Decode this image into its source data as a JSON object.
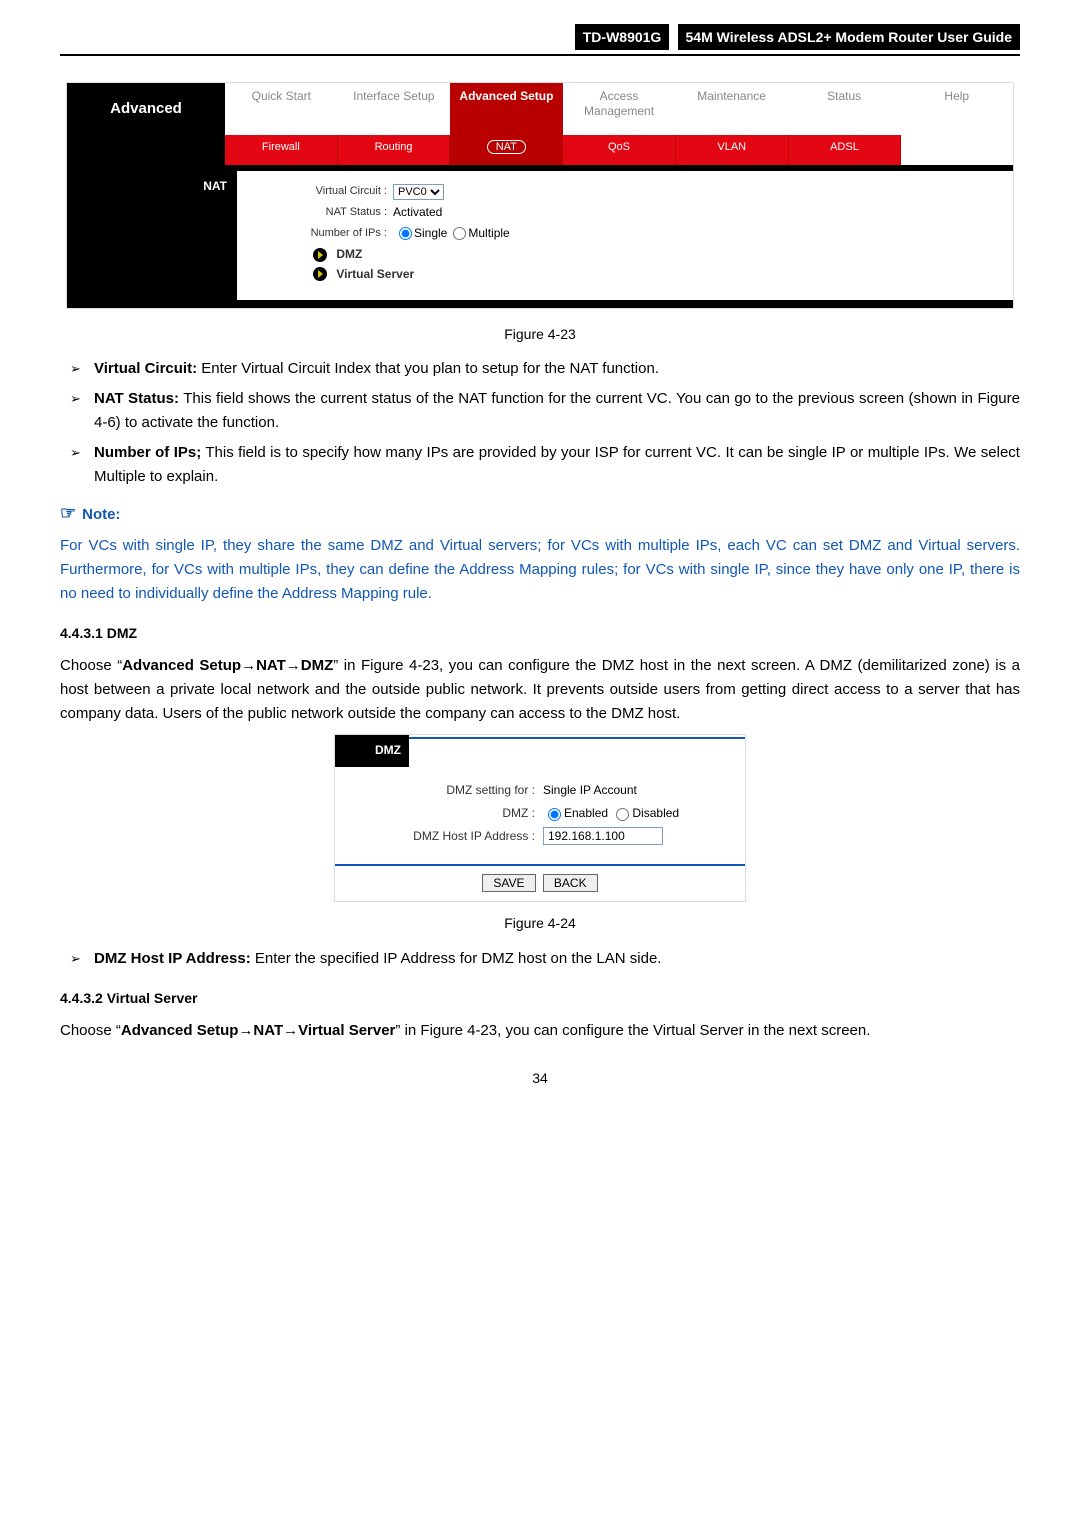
{
  "doc_header": {
    "model": "TD-W8901G",
    "title": "54M Wireless ADSL2+ Modem Router User Guide"
  },
  "fig23": {
    "sidebar_title": "Advanced",
    "nav1": [
      "Quick\nStart",
      "Interface\nSetup",
      "Advanced\nSetup",
      "Access\nManagement",
      "Maintenance",
      "Status",
      "Help"
    ],
    "nav1_active_index": 2,
    "nav2": [
      "Firewall",
      "Routing",
      "NAT",
      "QoS",
      "VLAN",
      "ADSL"
    ],
    "nav2_active_index": 2,
    "section_label": "NAT",
    "form": {
      "vc_label": "Virtual Circuit :",
      "vc_value": "PVC0",
      "nat_status_label": "NAT Status :",
      "nat_status_value": "Activated",
      "num_ips_label": "Number of IPs :",
      "num_ips_opt1": "Single",
      "num_ips_opt2": "Multiple",
      "link_dmz": "DMZ",
      "link_vs": "Virtual Server"
    },
    "caption": "Figure 4-23"
  },
  "bullets23": [
    {
      "term": "Virtual Circuit:",
      "text": " Enter Virtual Circuit Index that you plan to setup for the NAT function."
    },
    {
      "term": "NAT Status:",
      "text": " This field shows the current status of the NAT function for the current VC. You can go to the previous screen (shown in Figure 4-6) to activate the function."
    },
    {
      "term": "Number of IPs;",
      "text": " This field is to specify how many IPs are provided by your ISP for current VC. It can be single IP or multiple IPs. We select Multiple to explain."
    }
  ],
  "note": {
    "header": "Note:",
    "body": "For VCs with single IP, they share the same DMZ and Virtual servers; for VCs with multiple IPs, each VC can set DMZ and Virtual servers. Furthermore, for VCs with multiple IPs, they can define the Address Mapping rules; for VCs with single IP, since they have only one IP, there is no need to individually define the Address Mapping rule."
  },
  "sec_dmz": {
    "heading": "4.4.3.1   DMZ",
    "para_before": "Choose “",
    "path": "Advanced Setup→NAT→DMZ",
    "para_after": "” in Figure 4-23, you can configure the DMZ host in the next screen. A DMZ (demilitarized zone) is a host between a private local network and the outside public network. It prevents outside users from getting direct access to a server that has company data. Users of the public network outside the company can access to the DMZ host."
  },
  "fig24": {
    "side_label": "DMZ",
    "line1_label": "DMZ setting for :",
    "line1_value": "Single IP Account",
    "line2_label": "DMZ :",
    "line2_opt1": "Enabled",
    "line2_opt2": "Disabled",
    "line3_label": "DMZ Host IP Address :",
    "line3_value": "192.168.1.100",
    "btn_save": "SAVE",
    "btn_back": "BACK",
    "caption": "Figure 4-24"
  },
  "bullets24": [
    {
      "term": "DMZ Host IP Address:",
      "text": " Enter the specified IP Address for DMZ host on the LAN side."
    }
  ],
  "sec_vs": {
    "heading": "4.4.3.2   Virtual Server",
    "para_before": "Choose “",
    "path": "Advanced Setup→NAT→Virtual Server",
    "para_after": "” in Figure 4-23, you can configure the Virtual Server in the next screen."
  },
  "page_number": "34"
}
